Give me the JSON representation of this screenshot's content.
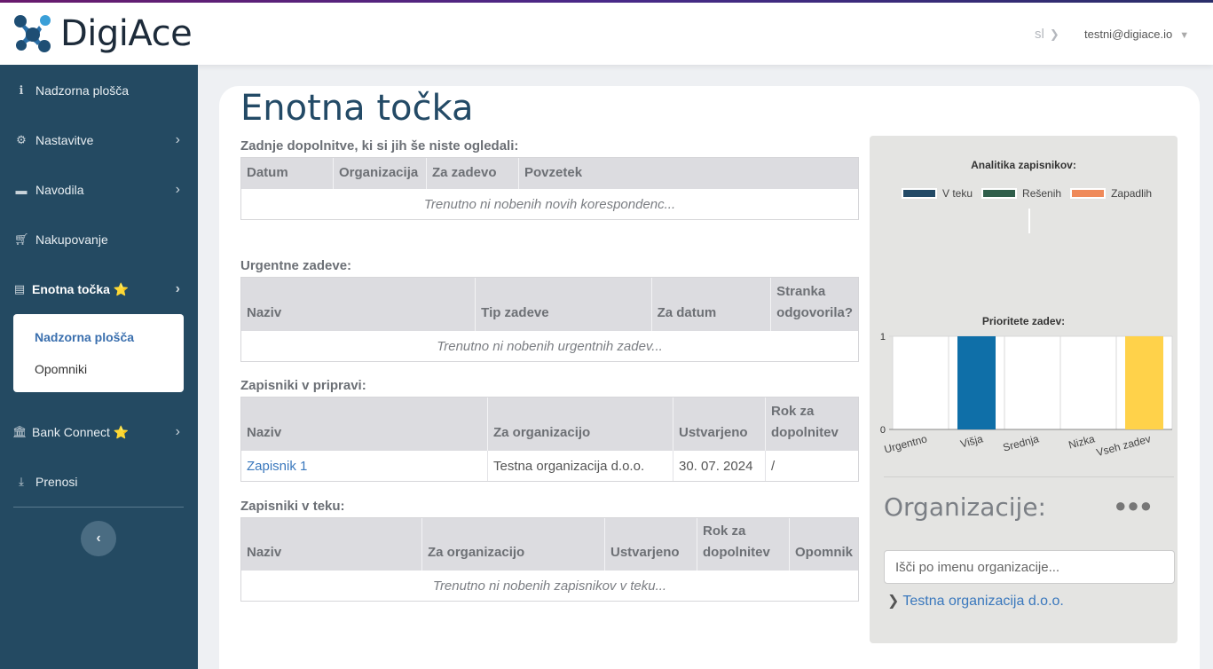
{
  "header": {
    "logo_text": "DigiAce",
    "lang": "sl",
    "user_email": "testni@digiace.io"
  },
  "sidebar": {
    "items": [
      {
        "label": "Nadzorna plošča",
        "icon": "info-icon"
      },
      {
        "label": "Nastavitve",
        "icon": "gear-icon"
      },
      {
        "label": "Navodila",
        "icon": "book-icon"
      },
      {
        "label": "Nakupovanje",
        "icon": "cart-icon"
      },
      {
        "label": "Enotna točka ⭐",
        "icon": "document-icon"
      },
      {
        "label": "Bank Connect ⭐",
        "icon": "bank-icon"
      },
      {
        "label": "Prenosi",
        "icon": "download-icon"
      }
    ],
    "submenu": [
      {
        "label": "Nadzorna plošča"
      },
      {
        "label": "Opomniki"
      }
    ]
  },
  "main": {
    "title": "Enotna točka",
    "recent": {
      "title": "Zadnje dopolnitve, ki si jih še niste ogledali:",
      "columns": [
        "Datum",
        "Organizacija",
        "Za zadevo",
        "Povzetek"
      ],
      "empty": "Trenutno ni nobenih novih korespondenc..."
    },
    "urgent": {
      "title": "Urgentne zadeve:",
      "columns": [
        "Naziv",
        "Tip zadeve",
        "Za datum",
        "Stranka odgovorila?"
      ],
      "empty": "Trenutno ni nobenih urgentnih zadev..."
    },
    "drafts": {
      "title": "Zapisniki v pripravi:",
      "columns": [
        "Naziv",
        "Za organizacijo",
        "Ustvarjeno",
        "Rok za dopolnitev"
      ],
      "rows": [
        [
          "Zapisnik 1",
          "Testna organizacija d.o.o.",
          "30. 07. 2024",
          "/"
        ]
      ]
    },
    "in_progress": {
      "title": "Zapisniki v teku:",
      "columns": [
        "Naziv",
        "Za organizacijo",
        "Ustvarjeno",
        "Rok za dopolnitev",
        "Opomnik"
      ],
      "empty": "Trenutno ni nobenih zapisnikov v teku..."
    }
  },
  "panel": {
    "analytics_title": "Analitika zapisnikov:",
    "legend": [
      {
        "name": "V teku",
        "color": "#234a66"
      },
      {
        "name": "Rešenih",
        "color": "#2f5e4a"
      },
      {
        "name": "Zapadlih",
        "color": "#ef8a5a"
      }
    ],
    "organizations_title": "Organizacije:",
    "search_placeholder": "Išči po imenu organizacije...",
    "org_link": "Testna organizacija d.o.o."
  },
  "chart_data": {
    "type": "bar",
    "title": "Prioritete zadev:",
    "categories": [
      "Urgentno",
      "Višja",
      "Srednja",
      "Nizka",
      "Vseh zadev"
    ],
    "values": [
      0,
      1,
      0,
      0,
      1
    ],
    "colors": [
      "#999999",
      "#0f6fa8",
      "#999999",
      "#999999",
      "#ffd24a"
    ],
    "ylim": [
      0,
      1
    ],
    "yticks": [
      0,
      1
    ],
    "grid": true
  }
}
